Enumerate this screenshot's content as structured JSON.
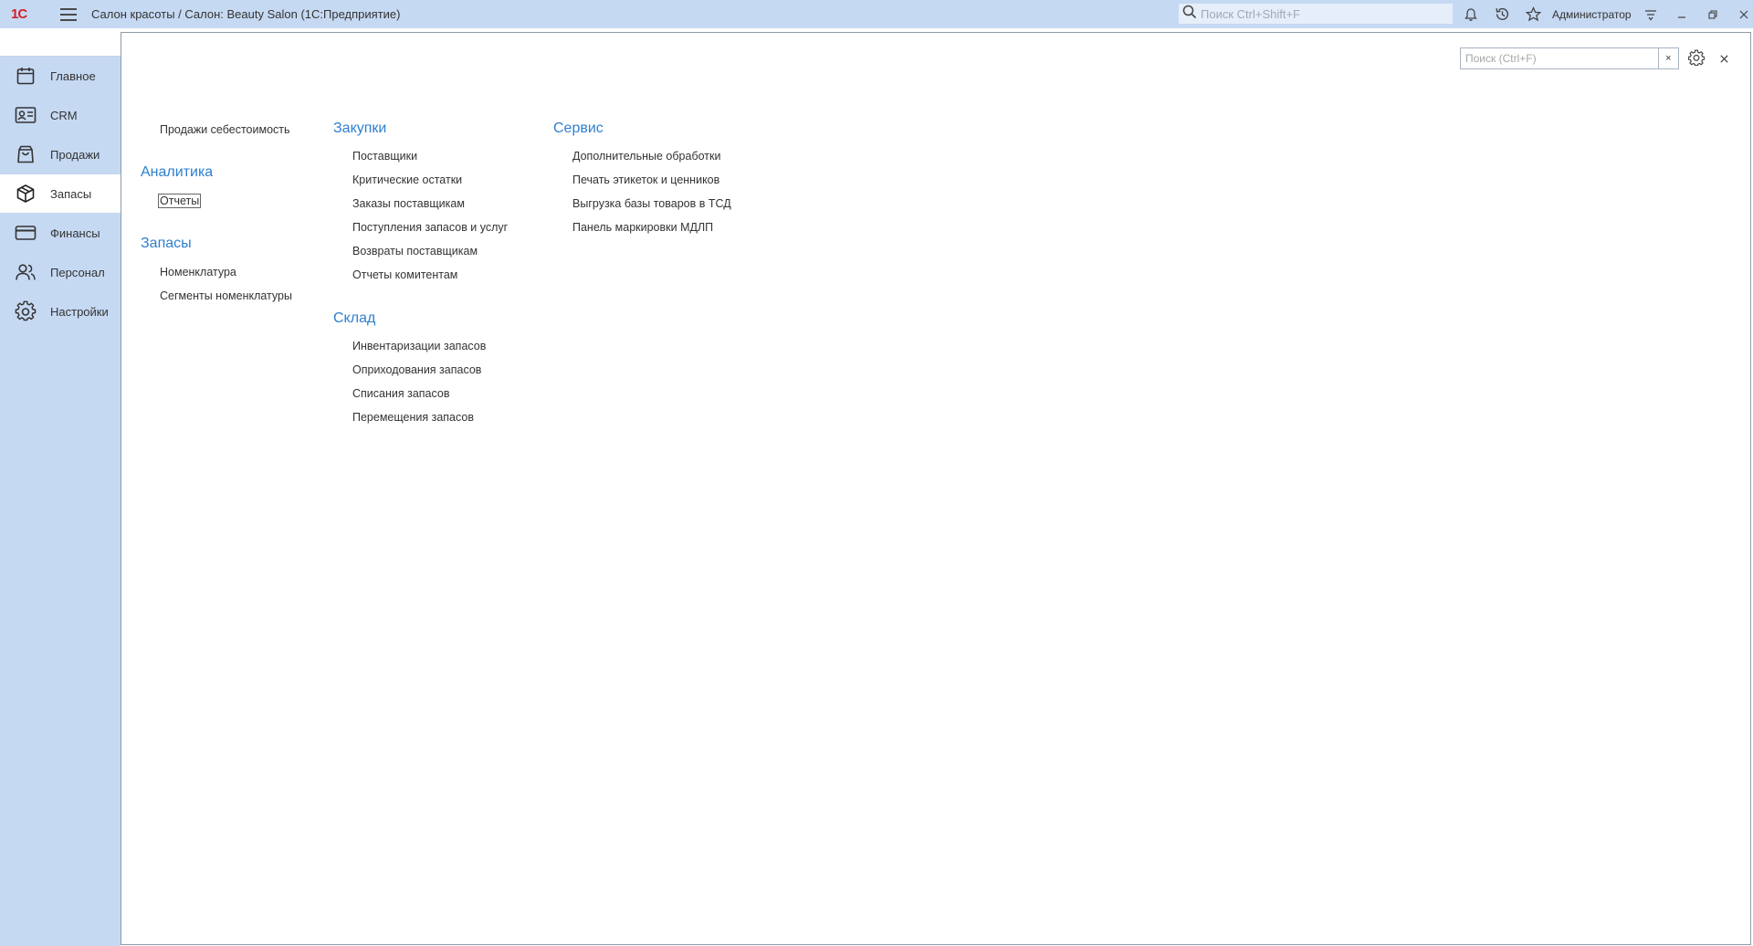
{
  "titlebar": {
    "logo": "1С",
    "title": "Салон красоты / Салон: Beauty Salon  (1С:Предприятие)",
    "search_placeholder": "Поиск Ctrl+Shift+F",
    "user": "Администратор"
  },
  "sidebar": {
    "items": [
      {
        "label": "Главное",
        "icon": "calendar-icon"
      },
      {
        "label": "CRM",
        "icon": "contact-card-icon"
      },
      {
        "label": "Продажи",
        "icon": "shopping-bag-icon"
      },
      {
        "label": "Запасы",
        "icon": "box-icon"
      },
      {
        "label": "Финансы",
        "icon": "credit-card-icon"
      },
      {
        "label": "Персонал",
        "icon": "people-icon"
      },
      {
        "label": "Настройки",
        "icon": "gear-icon"
      }
    ],
    "active": "Запасы"
  },
  "panel": {
    "search_placeholder": "Поиск (Ctrl+F)",
    "clear": "×",
    "col1": {
      "top_link": "Продажи себестоимость",
      "groups": [
        {
          "title": "Аналитика",
          "links": [
            "Отчеты"
          ]
        },
        {
          "title": "Запасы",
          "links": [
            "Номенклатура",
            "Сегменты номенклатуры"
          ]
        }
      ]
    },
    "col2": {
      "groups": [
        {
          "title": "Закупки",
          "links": [
            "Поставщики",
            "Критические остатки",
            "Заказы поставщикам",
            "Поступления запасов и услуг",
            "Возвраты поставщикам",
            "Отчеты комитентам"
          ]
        },
        {
          "title": "Склад",
          "links": [
            "Инвентаризации запасов",
            "Оприходования запасов",
            "Списания запасов",
            "Перемещения запасов"
          ]
        }
      ]
    },
    "col3": {
      "groups": [
        {
          "title": "Сервис",
          "links": [
            "Дополнительные обработки",
            "Печать этикеток и ценников",
            "Выгрузка базы товаров в ТСД",
            "Панель маркировки МДЛП"
          ]
        }
      ]
    }
  },
  "colors": {
    "accent": "#2e7fd0",
    "sidebar_bg": "#c6d9f3",
    "logo": "#d3222a"
  }
}
